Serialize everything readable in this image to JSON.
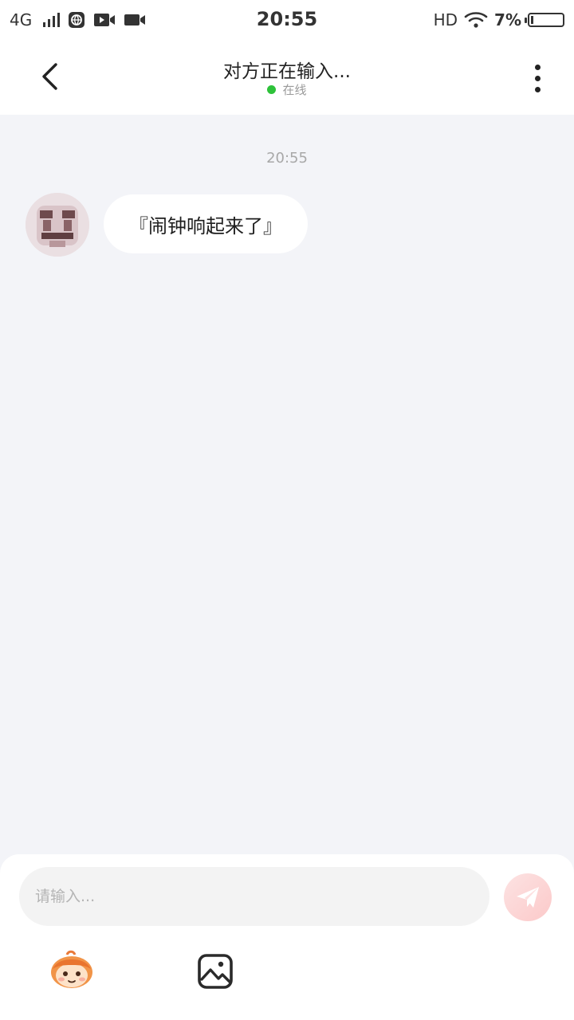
{
  "status_bar": {
    "network": "4G",
    "time": "20:55",
    "hd": "HD",
    "battery_percent": "7%",
    "icons": [
      "signal-icon",
      "globe-icon",
      "video-play-icon",
      "camera-icon",
      "wifi-icon",
      "battery-icon"
    ]
  },
  "header": {
    "title": "对方正在输入...",
    "status": "在线",
    "status_color": "#2ec23a",
    "icons": [
      "back-arrow-icon",
      "more-vertical-icon"
    ]
  },
  "chat": {
    "timestamp": "20:55",
    "messages": [
      {
        "sender": "other",
        "avatar": "avatar-image",
        "text": "『闹钟响起来了』"
      }
    ]
  },
  "composer": {
    "placeholder": "请输入...",
    "send_icon": "send-icon",
    "send_color": "#f7a8a8",
    "tools": [
      "emoji-mascot-icon",
      "image-icon"
    ]
  }
}
